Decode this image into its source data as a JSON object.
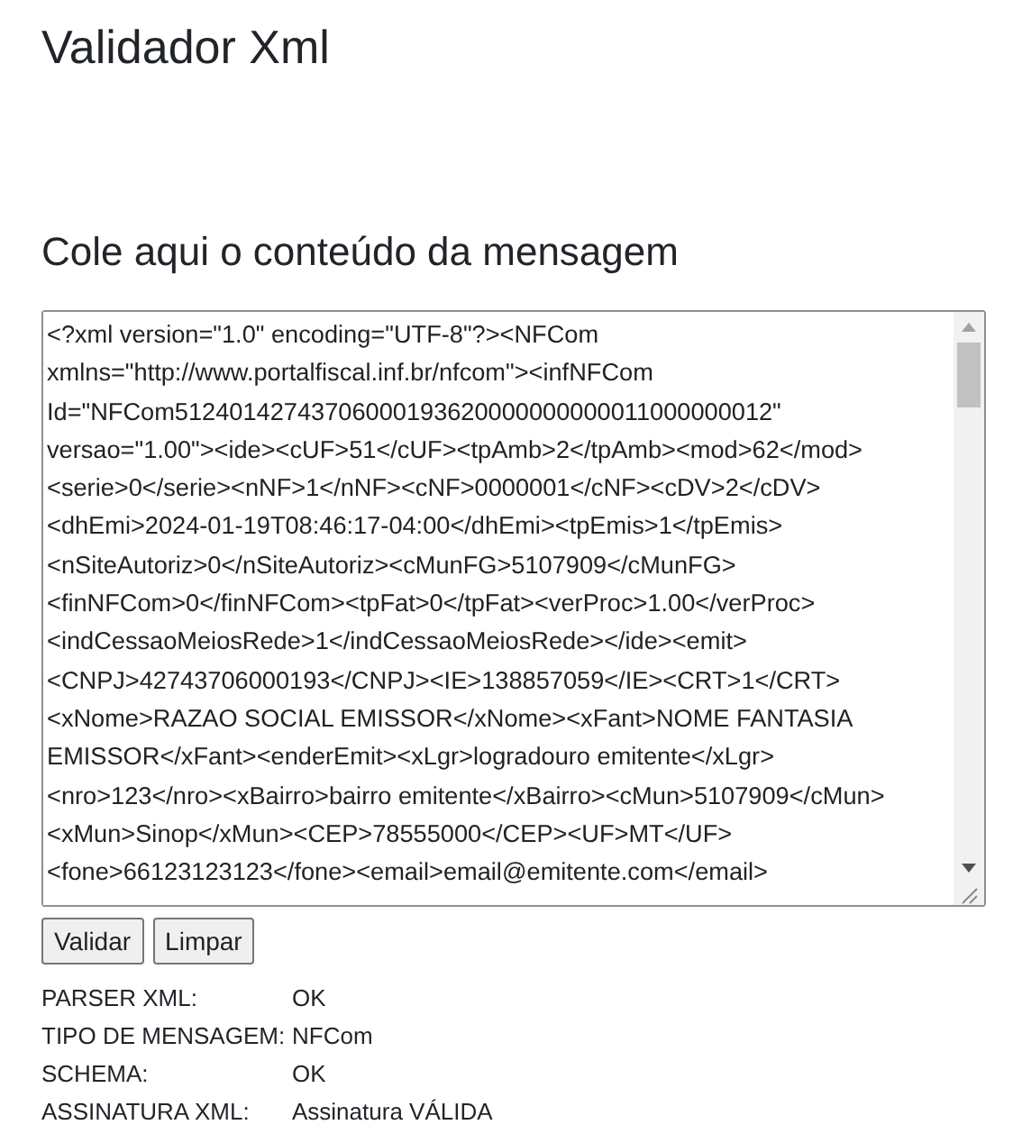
{
  "title": "Validador Xml",
  "section_heading": "Cole aqui o conteúdo da mensagem",
  "message_field": {
    "lines": [
      "<?xml version=\"1.0\" encoding=\"UTF-8\"?><NFCom",
      "xmlns=\"http://www.portalfiscal.inf.br/nfcom\"><infNFCom",
      "Id=\"NFCom51240142743706000193620000000000011000000012\"",
      "versao=\"1.00\"><ide><cUF>51</cUF><tpAmb>2</tpAmb><mod>62</mod>",
      "<serie>0</serie><nNF>1</nNF><cNF>0000001</cNF><cDV>2</cDV>",
      "<dhEmi>2024-01-19T08:46:17-04:00</dhEmi><tpEmis>1</tpEmis>",
      "<nSiteAutoriz>0</nSiteAutoriz><cMunFG>5107909</cMunFG>",
      "<finNFCom>0</finNFCom><tpFat>0</tpFat><verProc>1.00</verProc>",
      "<indCessaoMeiosRede>1</indCessaoMeiosRede></ide><emit>",
      "<CNPJ>42743706000193</CNPJ><IE>138857059</IE><CRT>1</CRT>",
      "<xNome>RAZAO SOCIAL EMISSOR</xNome><xFant>NOME FANTASIA",
      "EMISSOR</xFant><enderEmit><xLgr>logradouro emitente</xLgr>",
      "<nro>123</nro><xBairro>bairro emitente</xBairro><cMun>5107909</cMun>",
      "<xMun>Sinop</xMun><CEP>78555000</CEP><UF>MT</UF>",
      "<fone>66123123123</fone><email>email@emitente.com</email>"
    ]
  },
  "buttons": [
    "Validar",
    "Limpar"
  ],
  "results": [
    {
      "label": "PARSER XML:",
      "value": "OK"
    },
    {
      "label": "TIPO DE MENSAGEM:",
      "value": "NFCom"
    },
    {
      "label": "SCHEMA:",
      "value": "OK"
    },
    {
      "label": "ASSINATURA XML:",
      "value": "Assinatura VÁLIDA"
    }
  ]
}
